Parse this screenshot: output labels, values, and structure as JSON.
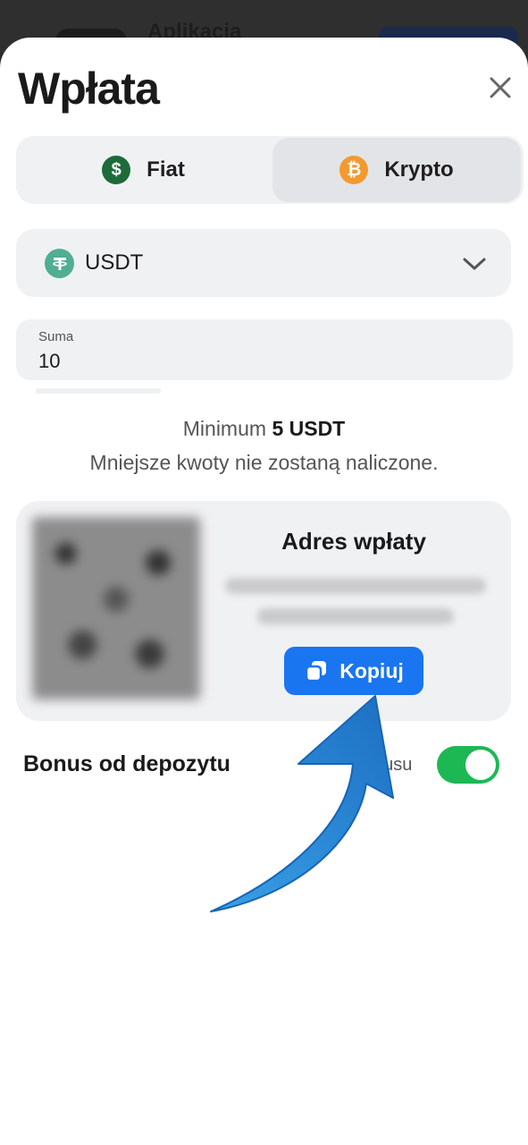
{
  "background": {
    "app_title": "Aplikacja"
  },
  "sheet": {
    "title": "Wpłata",
    "close_icon": "close-icon"
  },
  "tabs": [
    {
      "label": "Fiat",
      "icon": "dollar-coin-icon",
      "selected": false
    },
    {
      "label": "Krypto",
      "icon": "bitcoin-icon",
      "selected": true
    }
  ],
  "currency_select": {
    "value": "USDT",
    "icon": "tether-icon"
  },
  "amount_field": {
    "label": "Suma",
    "value": "10"
  },
  "info": {
    "minimum_prefix": "Minimum",
    "minimum_value": "5 USDT",
    "note": "Mniejsze kwoty nie zostaną naliczone."
  },
  "deposit_address": {
    "title": "Adres wpłaty",
    "copy_label": "Kopiuj"
  },
  "bonus": {
    "label": "Bonus od depozytu",
    "hint_partial": "nusu",
    "enabled": true
  },
  "colors": {
    "accent_blue": "#1a75f0",
    "toggle_green": "#1db853",
    "usdt_green": "#51ae93",
    "btc_orange": "#f39a2e",
    "arrow_blue": "#2a8ad6"
  }
}
